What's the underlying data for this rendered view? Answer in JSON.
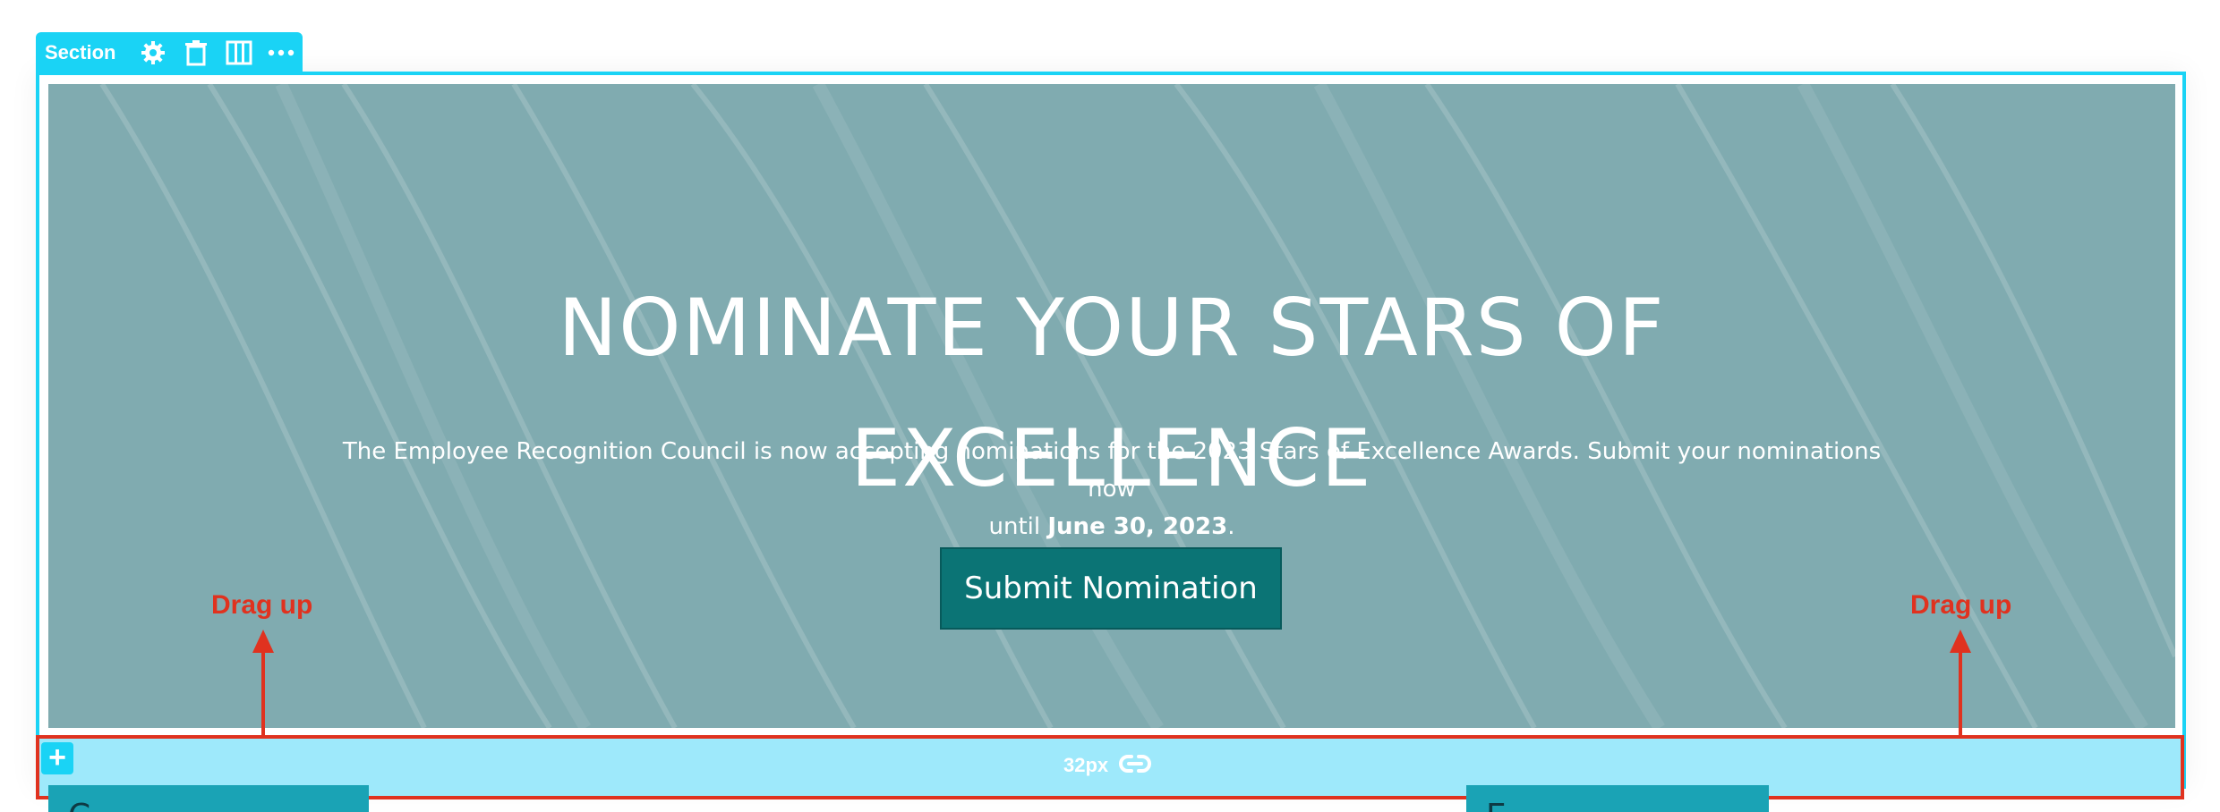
{
  "toolbar": {
    "label": "Section",
    "icons": [
      "gear-icon",
      "trash-icon",
      "columns-icon",
      "more-icon"
    ]
  },
  "hero": {
    "title_line1": "NOMINATE YOUR STARS OF",
    "title_line2": "EXCELLENCE",
    "subtitle": "The Employee Recognition Council is now accepting nominations for the 2023 Stars of Excellence Awards. Submit your nominations now",
    "subtitle_until": "until ",
    "subtitle_date": "June 30, 2023",
    "subtitle_end": ".",
    "button_label": "Submit Nomination"
  },
  "spacing": {
    "value": "32px"
  },
  "annotations": {
    "left_label": "Drag up",
    "right_label": "Drag up"
  },
  "below": {
    "left_text": "C",
    "right_text": "E"
  },
  "colors": {
    "accent": "#1ad3f5",
    "hero_bg": "#80abb0",
    "button": "#0b7475",
    "annotation": "#e0321f",
    "spacing_bg": "#9ee9fb"
  }
}
